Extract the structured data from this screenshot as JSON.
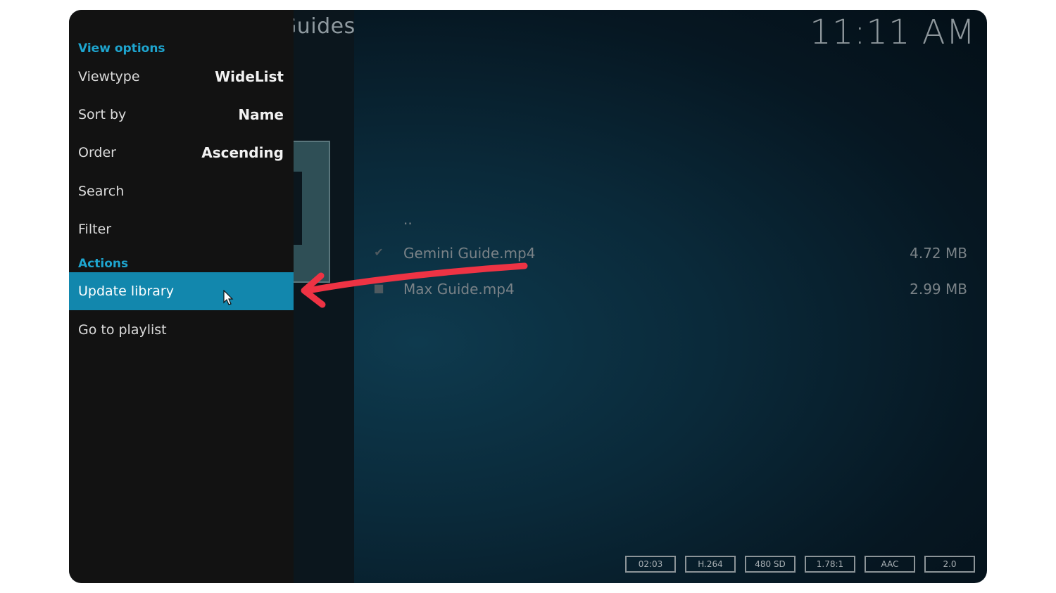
{
  "header": {
    "title": "Guides",
    "clock": "11:11 AM"
  },
  "side_menu": {
    "view_options_header": "View options",
    "view_options": [
      {
        "label": "Viewtype",
        "value": "WideList"
      },
      {
        "label": "Sort by",
        "value": "Name"
      },
      {
        "label": "Order",
        "value": "Ascending"
      },
      {
        "label": "Search",
        "value": ""
      },
      {
        "label": "Filter",
        "value": ""
      }
    ],
    "actions_header": "Actions",
    "actions": [
      {
        "label": "Update library",
        "selected": true
      },
      {
        "label": "Go to playlist",
        "selected": false
      }
    ]
  },
  "file_list": {
    "parent": "..",
    "files": [
      {
        "name": "Gemini Guide.mp4",
        "size": "4.72 MB",
        "watched": true
      },
      {
        "name": "Max Guide.mp4",
        "size": "2.99 MB",
        "watched": false
      }
    ]
  },
  "media_info": [
    "02:03",
    "H.264",
    "480 SD",
    "1.78:1",
    "AAC",
    "2.0"
  ],
  "colors": {
    "accent": "#1ea5cf",
    "selected_bg": "#1287ad",
    "annotation_arrow": "#ee3344"
  }
}
